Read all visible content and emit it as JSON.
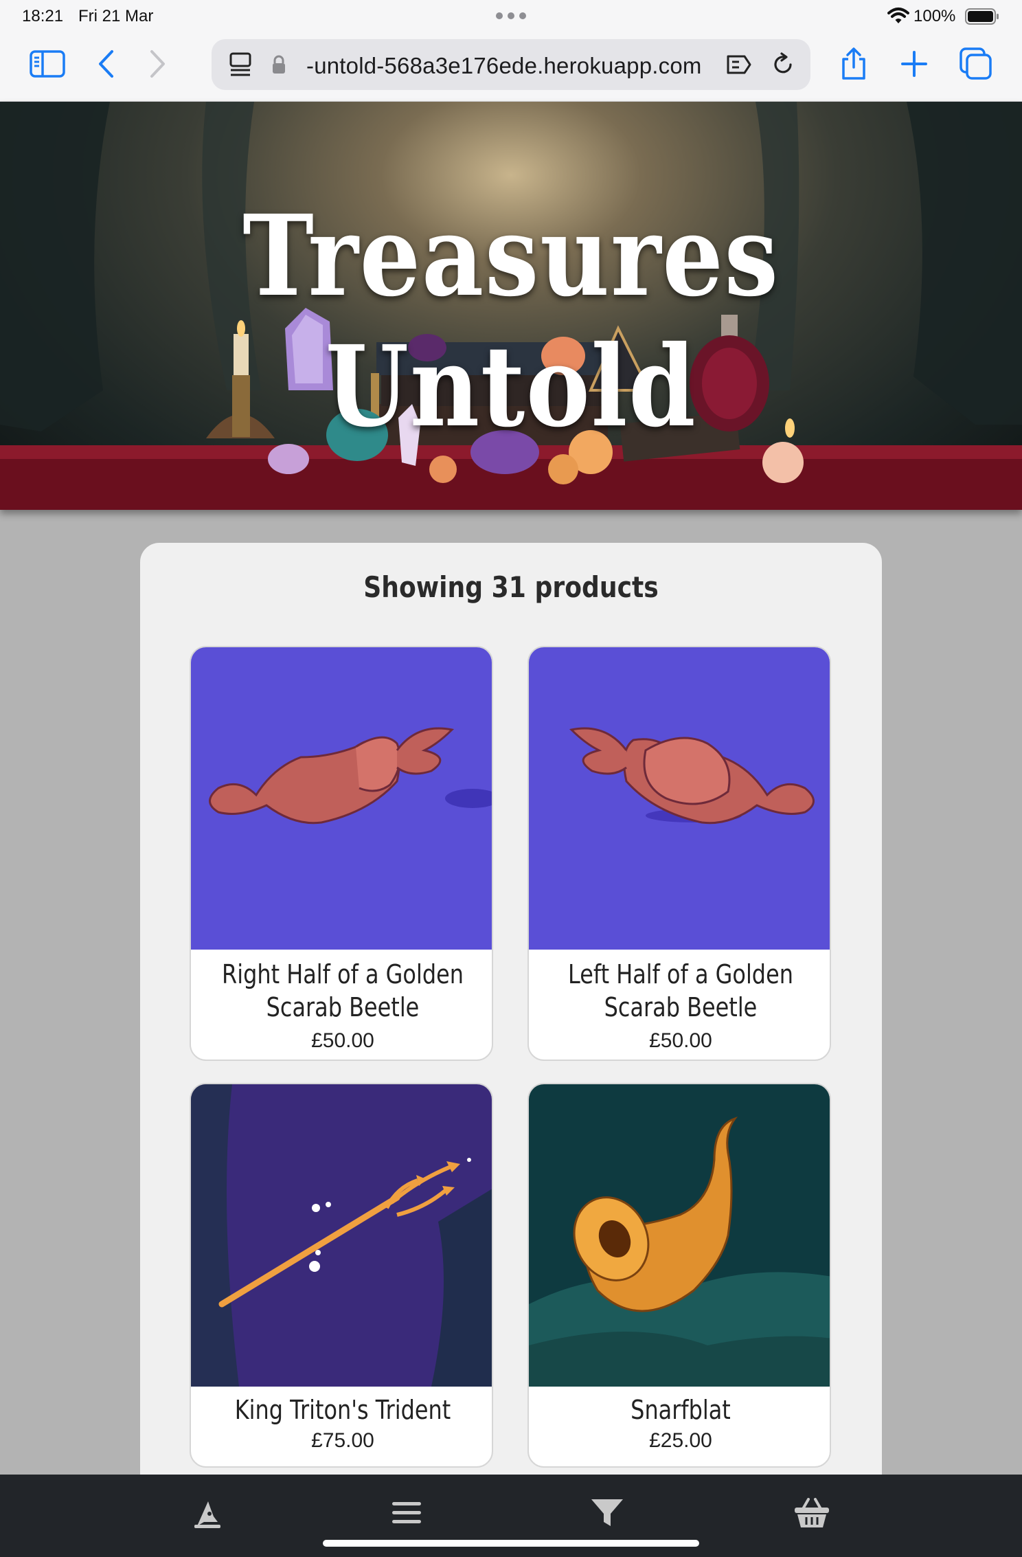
{
  "status_bar": {
    "time": "18:21",
    "date": "Fri 21 Mar",
    "battery": "100%"
  },
  "browser": {
    "url": "-untold-568a3e176ede.herokuapp.com",
    "icons": [
      "sidebar-icon",
      "back-icon",
      "forward-icon",
      "page-menu-icon",
      "lock-icon",
      "translate-icon",
      "reload-icon",
      "share-icon",
      "new-tab-icon",
      "tabs-icon"
    ]
  },
  "hero": {
    "title": "Treasures Untold"
  },
  "main": {
    "products_count": "Showing 31 products",
    "products": [
      {
        "name_line1": "Right Half of a Golden",
        "name_line2": "Scarab Beetle",
        "price": "£50.00",
        "image": "right-scarab-half"
      },
      {
        "name_line1": "Left Half of a Golden",
        "name_line2": "Scarab Beetle",
        "price": "£50.00",
        "image": "left-scarab-half"
      },
      {
        "name_line1": "King Triton's Trident",
        "name_line2": "",
        "price": "£75.00",
        "image": "trident"
      },
      {
        "name_line1": "Snarfblat",
        "name_line2": "",
        "price": "£25.00",
        "image": "snarfblat"
      }
    ]
  },
  "bottom_nav": {
    "items": [
      "wizard-hat-icon",
      "menu-icon",
      "filter-icon",
      "basket-icon"
    ]
  },
  "colors": {
    "panel_bg": "#f0f0f0",
    "page_bg": "#b3b3b3",
    "nav_bg": "#222529",
    "accent_blue": "#1a7cf5",
    "card_purple": "#5a4fd6"
  }
}
